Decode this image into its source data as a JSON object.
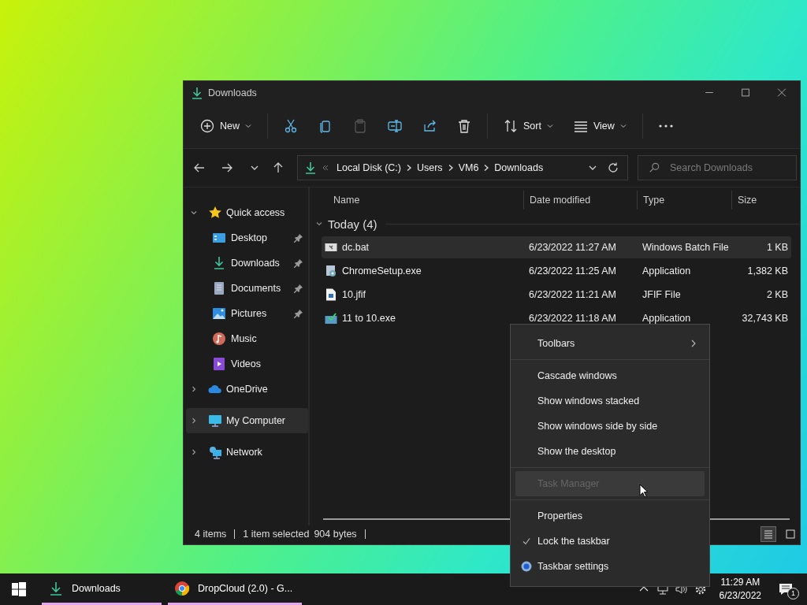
{
  "window": {
    "title": "Downloads",
    "toolbar": [
      {
        "kind": "new",
        "label": "New",
        "disabled": false
      },
      {
        "kind": "separator"
      },
      {
        "kind": "cut",
        "disabled": false
      },
      {
        "kind": "copy",
        "disabled": false
      },
      {
        "kind": "paste",
        "disabled": true
      },
      {
        "kind": "rename",
        "disabled": false
      },
      {
        "kind": "share",
        "disabled": false
      },
      {
        "kind": "delete",
        "disabled": false
      },
      {
        "kind": "separator"
      },
      {
        "kind": "sort",
        "label": "Sort",
        "disabled": false
      },
      {
        "kind": "view",
        "label": "View",
        "disabled": false
      },
      {
        "kind": "separator"
      },
      {
        "kind": "more",
        "disabled": false
      }
    ],
    "breadcrumbs": [
      "Local Disk (C:)",
      "Users",
      "VM6",
      "Downloads"
    ],
    "search": {
      "placeholder": "Search Downloads"
    },
    "sidebar": {
      "items": [
        {
          "label": "Quick access",
          "kind": "star",
          "expanded": true,
          "selected": false,
          "children": [
            {
              "label": "Desktop",
              "kind": "desktop",
              "pinned": true,
              "selected": false
            },
            {
              "label": "Downloads",
              "kind": "download",
              "pinned": true,
              "selected": false
            },
            {
              "label": "Documents",
              "kind": "document",
              "pinned": true,
              "selected": false
            },
            {
              "label": "Pictures",
              "kind": "pictures",
              "pinned": true,
              "selected": false
            },
            {
              "label": "Music",
              "kind": "music",
              "pinned": false,
              "selected": false
            },
            {
              "label": "Videos",
              "kind": "videos",
              "pinned": false,
              "selected": false
            }
          ]
        },
        {
          "label": "OneDrive",
          "kind": "cloud",
          "expanded": false,
          "selected": false
        },
        {
          "label": "My Computer",
          "kind": "computer",
          "expanded": false,
          "selected": true
        },
        {
          "label": "Network",
          "kind": "network",
          "expanded": false,
          "selected": false
        }
      ]
    },
    "table": {
      "columns": [
        "Name",
        "Date modified",
        "Type",
        "Size"
      ],
      "group": {
        "label": "Today (4)",
        "expanded": true
      },
      "rows": [
        {
          "kind": "batch",
          "name": "dc.bat",
          "date": "6/23/2022 11:27 AM",
          "type": "Windows Batch File",
          "size": "1 KB",
          "selected": true
        },
        {
          "kind": "installer",
          "name": "ChromeSetup.exe",
          "date": "6/23/2022 11:25 AM",
          "type": "Application",
          "size": "1,382 KB",
          "selected": false
        },
        {
          "kind": "image",
          "name": "10.jfif",
          "date": "6/23/2022 11:21 AM",
          "type": "JFIF File",
          "size": "2 KB",
          "selected": false
        },
        {
          "kind": "app",
          "name": "11 to 10.exe",
          "date": "6/23/2022 11:18 AM",
          "type": "Application",
          "size": "32,743 KB",
          "selected": false
        }
      ]
    },
    "status_bar": {
      "item_count": "4 items",
      "selection": "1 item selected",
      "selection_size": "904 bytes"
    },
    "view_buttons": [
      {
        "kind": "details",
        "selected": true
      },
      {
        "kind": "tiles",
        "selected": false
      }
    ]
  },
  "context_menu": {
    "items": [
      {
        "kind": "submenu",
        "label": "Toolbars",
        "disabled": false,
        "checked": false,
        "hovered": false
      },
      {
        "kind": "separator"
      },
      {
        "kind": "item",
        "label": "Cascade windows",
        "disabled": false,
        "checked": false,
        "hovered": false
      },
      {
        "kind": "item",
        "label": "Show windows stacked",
        "disabled": false,
        "checked": false,
        "hovered": false
      },
      {
        "kind": "item",
        "label": "Show windows side by side",
        "disabled": false,
        "checked": false,
        "hovered": false
      },
      {
        "kind": "item",
        "label": "Show the desktop",
        "disabled": false,
        "checked": false,
        "hovered": false
      },
      {
        "kind": "separator"
      },
      {
        "kind": "item",
        "label": "Task Manager",
        "disabled": true,
        "checked": false,
        "hovered": true
      },
      {
        "kind": "separator"
      },
      {
        "kind": "item",
        "label": "Properties",
        "disabled": false,
        "checked": false,
        "hovered": false
      },
      {
        "kind": "item",
        "label": "Lock the taskbar",
        "disabled": false,
        "checked": true,
        "hovered": false
      },
      {
        "kind": "settings",
        "label": "Taskbar settings",
        "disabled": false,
        "checked": false,
        "hovered": false
      }
    ]
  },
  "taskbar": {
    "apps": [
      {
        "kind": "explorer",
        "label": "Downloads",
        "running": true
      },
      {
        "kind": "browser",
        "label": "DropCloud (2.0) - G...",
        "running": true
      }
    ],
    "time": "11:29 AM",
    "date": "6/23/2022",
    "notifications": "1"
  }
}
